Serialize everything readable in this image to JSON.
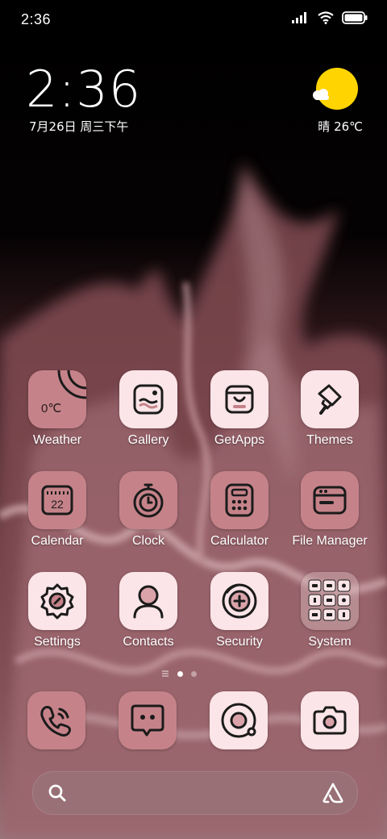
{
  "status_bar": {
    "time": "2:36"
  },
  "clock_widget": {
    "time": "2:36",
    "date": "7月26日 周三下午"
  },
  "weather_widget": {
    "condition_temp": "晴 26℃"
  },
  "apps": [
    {
      "label": "Weather",
      "icon": "weather-icon",
      "style": "rose",
      "badge_text": "0℃"
    },
    {
      "label": "Gallery",
      "icon": "gallery-icon",
      "style": "light"
    },
    {
      "label": "GetApps",
      "icon": "getapps-icon",
      "style": "light"
    },
    {
      "label": "Themes",
      "icon": "themes-icon",
      "style": "light"
    },
    {
      "label": "Calendar",
      "icon": "calendar-icon",
      "style": "rose",
      "badge_text": "22"
    },
    {
      "label": "Clock",
      "icon": "clock-icon",
      "style": "rose"
    },
    {
      "label": "Calculator",
      "icon": "calculator-icon",
      "style": "rose"
    },
    {
      "label": "File Manager",
      "icon": "file-manager-icon",
      "style": "rose"
    },
    {
      "label": "Settings",
      "icon": "settings-icon",
      "style": "light"
    },
    {
      "label": "Contacts",
      "icon": "contacts-icon",
      "style": "light"
    },
    {
      "label": "Security",
      "icon": "security-icon",
      "style": "light"
    },
    {
      "label": "System",
      "icon": "system-folder-icon",
      "style": "folder"
    }
  ],
  "dock": [
    {
      "icon": "phone-icon",
      "style": "rose"
    },
    {
      "icon": "messages-icon",
      "style": "rose"
    },
    {
      "icon": "browser-icon",
      "style": "light"
    },
    {
      "icon": "camera-icon",
      "style": "light"
    }
  ],
  "pager": {
    "pages": 2,
    "current": 1
  },
  "colors": {
    "icon_light": "#fbe5e8",
    "icon_rose": "#c58389",
    "sun": "#ffd400"
  }
}
